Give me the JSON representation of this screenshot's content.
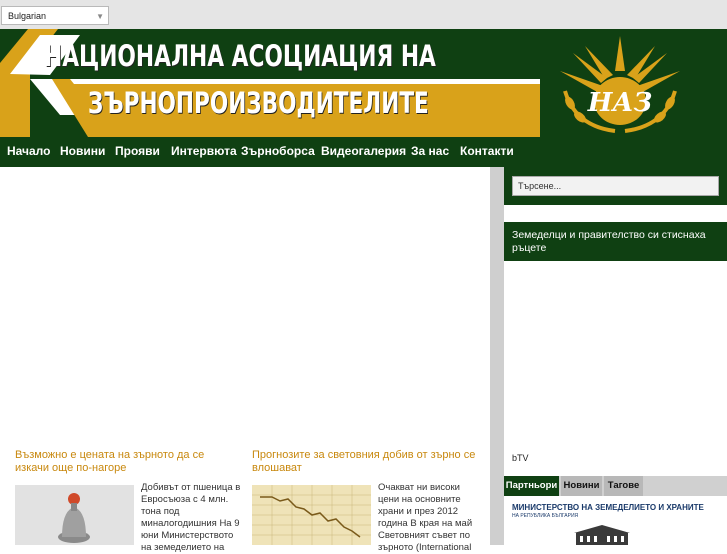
{
  "language_select": {
    "value": "Bulgarian"
  },
  "header": {
    "title_line1": "НАЦИОНАЛНА АСОЦИАЦИЯ НА",
    "title_line2": "ЗЪРНОПРОИЗВОДИТЕЛИТЕ",
    "logo_text": "НАЗ"
  },
  "nav": {
    "items": [
      {
        "label": "Начало"
      },
      {
        "label": "Новини"
      },
      {
        "label": "Прояви"
      },
      {
        "label": "Интервюта"
      },
      {
        "label": "Зърноборса"
      },
      {
        "label": "Видеогалерия"
      },
      {
        "label": "За нас"
      },
      {
        "label": "Контакти"
      }
    ]
  },
  "articles": [
    {
      "title": "Възможно е цената на зърното да се изкачи още по-нагоре",
      "text": "Добивът от пшеница в Евросъюза с 4 млн. тона под миналогодишния На 9 юни Министерството на земеделието на"
    },
    {
      "title": "Прогнозите за световния добив от зърно се влошават",
      "text": "Очакват ни високи цени на основните храни и през 2012 година В края на май Световният съвет по зърното (International"
    }
  ],
  "sidebar": {
    "search_placeholder": "Търсене...",
    "video_title": "Земеделци и правителство си стиснаха ръцете",
    "video_source": "bTV",
    "tabs": [
      {
        "label": "Партньори"
      },
      {
        "label": "Новини"
      },
      {
        "label": "Тагове"
      }
    ],
    "partner_title": "МИНИСТЕРСТВО НА ЗЕМЕДЕЛИЕТО И ХРАНИТЕ",
    "partner_sub": "НА РЕПУБЛИКА БЪЛГАРИЯ"
  },
  "colors": {
    "header_green": "#0f4012",
    "accent_gold": "#c8880e",
    "band_gold": "#d9a21a"
  }
}
